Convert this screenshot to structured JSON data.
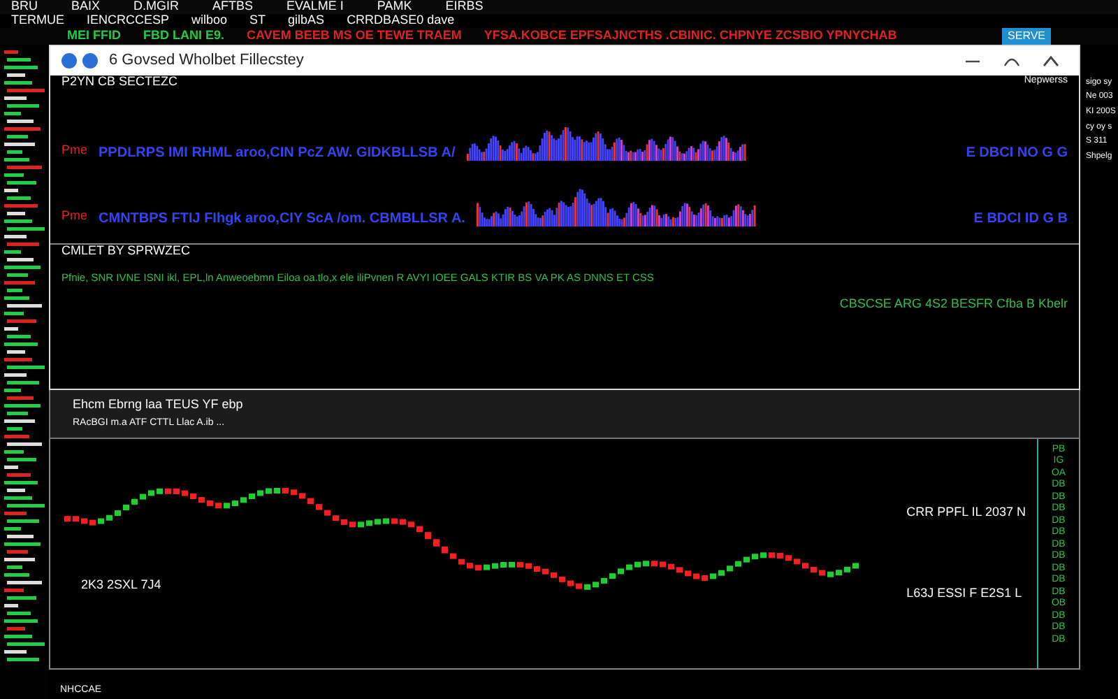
{
  "menu": [
    "BRU",
    "BAIX",
    "D.MGIR",
    "AFTBS",
    "EVALME I",
    "PAMK",
    "EIRBS"
  ],
  "toolbar": [
    "TERMUE",
    "IENCRCCESP",
    "wilboo",
    "ST",
    "gilbAS",
    "CRRDBASE0 dave"
  ],
  "ticker": [
    {
      "text": "MEI FFID",
      "color": "#22cc44"
    },
    {
      "text": "FBD LANI E9.",
      "color": "#22cc44"
    },
    {
      "text": "CAVEM BEEB MS OE TEWE TRAEM",
      "color": "#dd2222"
    },
    {
      "text": "YFSA.KOBCE  EPFSAJNCTHS  .CBINIC. CHPNYE  ZCSBIO  YPNYCHAB",
      "color": "#dd2222"
    }
  ],
  "ticker_badge": "SERVE",
  "window": {
    "title": "6 Govsed Wholbet Fillecstey"
  },
  "upper_chart": {
    "title": "P2YN CB SECTEZC",
    "corner": "Nepwerss",
    "rows": [
      {
        "tag": "Pme",
        "text": "PPDLRPS IMI RHML aroo,CIN PcZ AW. GIDKBLLSB A/",
        "tail": "E DBCI NO G G"
      },
      {
        "tag": "Pme",
        "text": "CMNTBPS FTIJ FIhgk aroo,CIY ScA /om. CBMBLLSR A.",
        "tail": "E BDCI ID G B"
      }
    ],
    "subtitle": "CMLET BY SPRWZEC",
    "bottom_row": "Pfnie, SNR IVNE ISNI ikl, EPL,ln Anweoebmn Eiloa oa.tlo,x ele iliPvnen R AVYI IOEE GALS KTIR BS VA PK AS DNNS ET CSS",
    "footer": "CBSCSE ARG 4S2 BESFR  Cfba B Kbelr"
  },
  "side_notes": [
    "sigo sy",
    "Ne 003",
    "KI 200S",
    "cy oy s",
    "S 311",
    "Shpelg"
  ],
  "lower_panel": {
    "title": "Ehcm Ebrng laa TEUS YF ebp",
    "subtitle": "RAcBGI  m.a  ATF CTTL Llac  A.ib  ..."
  },
  "candle_chart": {
    "low_label": "2K3 2SXL 7J4",
    "upper_label": "CRR PPFL IL 2037 N",
    "lower_label": "L63J ESSI F E2S1 L",
    "axis": [
      "PB",
      "IG",
      "OA",
      "DB",
      "DB",
      "DB",
      "DB",
      "DB",
      "DB",
      "DB",
      "DB",
      "DB",
      "DB",
      "OB",
      "DB",
      "DB",
      "DB"
    ]
  },
  "status_bar": "NHCCAE"
}
